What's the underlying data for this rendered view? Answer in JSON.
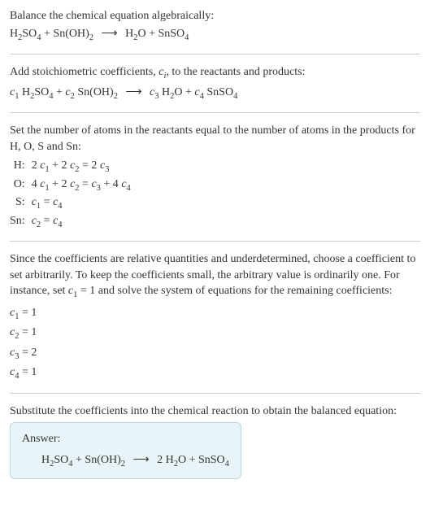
{
  "section1": {
    "intro": "Balance the chemical equation algebraically:",
    "eq_lhs1": "H",
    "eq_lhs1_sub": "2",
    "eq_lhs2": "SO",
    "eq_lhs2_sub": "4",
    "plus1": " + Sn(OH)",
    "plus1_sub": "2",
    "arrow": "⟶",
    "rhs1": "H",
    "rhs1_sub": "2",
    "rhs2": "O + SnSO",
    "rhs2_sub": "4"
  },
  "section2": {
    "intro_a": "Add stoichiometric coefficients, ",
    "ci": "c",
    "ci_sub": "i",
    "intro_b": ", to the reactants and products:",
    "c1": "c",
    "c1_sub": "1",
    "sp1": " H",
    "sp1_sub": "2",
    "sp2": "SO",
    "sp2_sub": "4",
    "plus": " + ",
    "c2": "c",
    "c2_sub": "2",
    "sp3": " Sn(OH)",
    "sp3_sub": "2",
    "arrow": "⟶",
    "c3": "c",
    "c3_sub": "3",
    "sp4": " H",
    "sp4_sub": "2",
    "sp5": "O + ",
    "c4": "c",
    "c4_sub": "4",
    "sp6": " SnSO",
    "sp6_sub": "4"
  },
  "section3": {
    "intro": "Set the number of atoms in the reactants equal to the number of atoms in the products for H, O, S and Sn:",
    "rows": {
      "h_lbl": "H:",
      "h_eq_a": "2 ",
      "h_c1": "c",
      "h_c1s": "1",
      "h_mid": " + 2 ",
      "h_c2": "c",
      "h_c2s": "2",
      "h_eq": " = 2 ",
      "h_c3": "c",
      "h_c3s": "3",
      "o_lbl": "O:",
      "o_a": "4 ",
      "o_c1": "c",
      "o_c1s": "1",
      "o_mid": " + 2 ",
      "o_c2": "c",
      "o_c2s": "2",
      "o_eq": " = ",
      "o_c3": "c",
      "o_c3s": "3",
      "o_mid2": " + 4 ",
      "o_c4": "c",
      "o_c4s": "4",
      "s_lbl": "S:",
      "s_c1": "c",
      "s_c1s": "1",
      "s_eq": " = ",
      "s_c4": "c",
      "s_c4s": "4",
      "sn_lbl": "Sn:",
      "sn_c2": "c",
      "sn_c2s": "2",
      "sn_eq": " = ",
      "sn_c4": "c",
      "sn_c4s": "4"
    }
  },
  "section4": {
    "intro_a": "Since the coefficients are relative quantities and underdetermined, choose a coefficient to set arbitrarily. To keep the coefficients small, the arbitrary value is ordinarily one. For instance, set ",
    "c1": "c",
    "c1s": "1",
    "intro_b": " = 1 and solve the system of equations for the remaining coefficients:",
    "l1_c": "c",
    "l1_s": "1",
    "l1_v": " = 1",
    "l2_c": "c",
    "l2_s": "2",
    "l2_v": " = 1",
    "l3_c": "c",
    "l3_s": "3",
    "l3_v": " = 2",
    "l4_c": "c",
    "l4_s": "4",
    "l4_v": " = 1"
  },
  "section5": {
    "intro": "Substitute the coefficients into the chemical reaction to obtain the balanced equation:",
    "answer_label": "Answer:",
    "lhs1": "H",
    "lhs1s": "2",
    "lhs2": "SO",
    "lhs2s": "4",
    "plus1": " + Sn(OH)",
    "plus1s": "2",
    "arrow": "⟶",
    "rhs_pre": " 2 H",
    "rhs_pres": "2",
    "rhs2": "O + SnSO",
    "rhs2s": "4"
  }
}
